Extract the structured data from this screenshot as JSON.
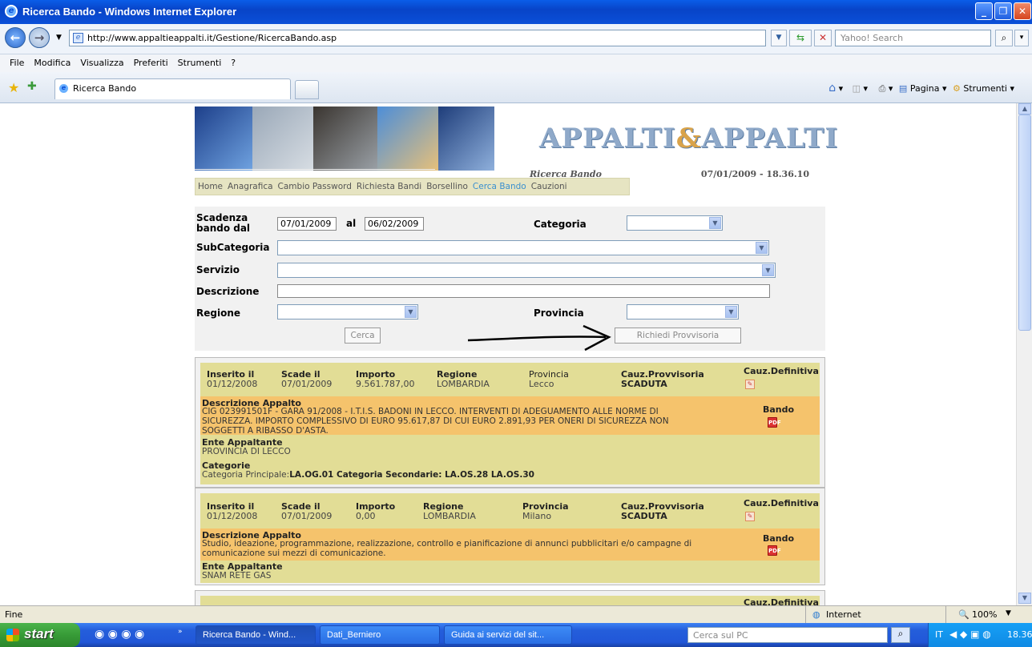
{
  "window": {
    "title": "Ricerca Bando - Windows Internet Explorer"
  },
  "addressbar": {
    "url": "http://www.appaltieappalti.it/Gestione/RicercaBando.asp",
    "search_placeholder": "Yahoo! Search"
  },
  "menu": [
    "File",
    "Modifica",
    "Visualizza",
    "Preferiti",
    "Strumenti",
    "?"
  ],
  "tabs": {
    "active": "Ricerca Bando"
  },
  "toolbar_right": {
    "pagina": "Pagina",
    "strumenti": "Strumenti"
  },
  "page": {
    "logo": {
      "left": "APPALTI",
      "amp": "&",
      "right": "APPALTI"
    },
    "section_title": "Ricerca Bando",
    "datetime": "07/01/2009 - 18.36.10",
    "nav": [
      "Home",
      "Anagrafica",
      "Cambio Password",
      "Richiesta Bandi",
      "Borsellino",
      "Cerca Bando",
      "Cauzioni"
    ],
    "nav_active": "Cerca Bando",
    "form": {
      "scadenza_label": "Scadenza bando dal",
      "date_from": "07/01/2009",
      "al_label": "al",
      "date_to": "06/02/2009",
      "categoria_label": "Categoria",
      "subcategoria_label": "SubCategoria",
      "servizio_label": "Servizio",
      "descrizione_label": "Descrizione",
      "regione_label": "Regione",
      "provincia_label": "Provincia",
      "cerca_button": "Cerca",
      "richiedi_button": "Richiedi Provvisoria"
    },
    "results": [
      {
        "inserito_label": "Inserito il",
        "inserito": "01/12/2008",
        "scade_label": "Scade il",
        "scade": "07/01/2009",
        "importo_label": "Importo",
        "importo": "9.561.787,00",
        "regione_label": "Regione",
        "regione": "LOMBARDIA",
        "provincia_label": "Provincia",
        "provincia": "Lecco",
        "cauz_prov_label": "Cauz.Provvisoria",
        "cauz_prov": "SCADUTA",
        "cauz_def_label": "Cauz.Definitiva",
        "descr_label": "Descrizione Appalto",
        "descr_lines": [
          "CIG 023991501F - GARA 91/2008 - I.T.I.S. BADONI IN LECCO. INTERVENTI DI ADEGUAMENTO ALLE NORME DI",
          "SICUREZZA. IMPORTO COMPLESSIVO DI EURO 95.617,87 DI CUI EURO 2.891,93 PER ONERI DI SICUREZZA NON",
          "SOGGETTI A RIBASSO D'ASTA."
        ],
        "bando_label": "Bando",
        "ente_label": "Ente Appaltante",
        "ente": "PROVINCIA DI LECCO",
        "categorie_label": "Categorie",
        "categorie_prefix": "Categoria Principale:",
        "categorie_value": "LA.OG.01 Categoria Secondarie: LA.OS.28 LA.OS.30"
      },
      {
        "inserito_label": "Inserito il",
        "inserito": "01/12/2008",
        "scade_label": "Scade il",
        "scade": "07/01/2009",
        "importo_label": "Importo",
        "importo": "0,00",
        "regione_label": "Regione",
        "regione": "LOMBARDIA",
        "provincia_label": "Provincia",
        "provincia": "Milano",
        "cauz_prov_label": "Cauz.Provvisoria",
        "cauz_prov": "SCADUTA",
        "cauz_def_label": "Cauz.Definitiva",
        "descr_label": "Descrizione Appalto",
        "descr_lines": [
          "Studio, ideazione, programmazione, realizzazione, controllo e pianificazione di annunci pubblicitari e/o campagne di",
          "comunicazione sui mezzi di comunicazione."
        ],
        "bando_label": "Bando",
        "ente_label": "Ente Appaltante",
        "ente": "SNAM RETE GAS"
      }
    ],
    "partial_card_label": "Cauz.Definitiva"
  },
  "statusbar": {
    "left": "Fine",
    "zone": "Internet",
    "zoom": "100%"
  },
  "taskbar": {
    "start": "start",
    "buttons": [
      "Ricerca Bando - Wind...",
      "Dati_Berniero",
      "Guida ai servizi del sit..."
    ],
    "search_placeholder": "Cerca sul PC",
    "lang": "IT",
    "clock": "18.36"
  }
}
